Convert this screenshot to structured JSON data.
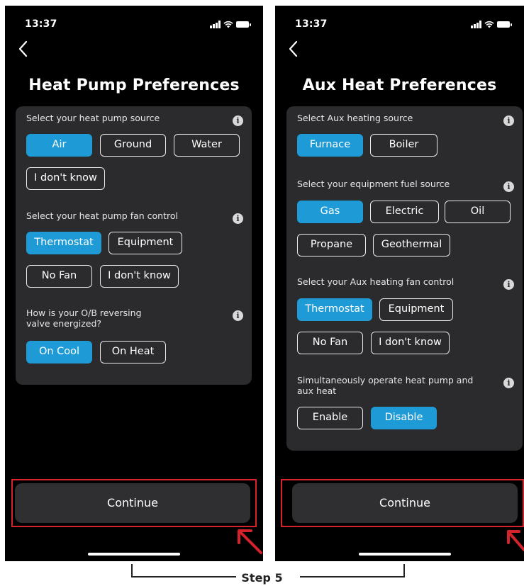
{
  "status": {
    "time": "13:37"
  },
  "left": {
    "title": "Heat Pump Preferences",
    "sections": [
      {
        "label": "Select your heat pump source",
        "options": [
          "Air",
          "Ground",
          "Water",
          "I don't know"
        ],
        "selected": "Air"
      },
      {
        "label": "Select your heat pump fan control",
        "options": [
          "Thermostat",
          "Equipment",
          "No Fan",
          "I don't know"
        ],
        "selected": "Thermostat"
      },
      {
        "label": "How is your O/B reversing valve energized?",
        "options": [
          "On Cool",
          "On Heat"
        ],
        "selected": "On Cool"
      }
    ],
    "continue_label": "Continue"
  },
  "right": {
    "title": "Aux Heat Preferences",
    "sections": [
      {
        "label": "Select Aux heating source",
        "options": [
          "Furnace",
          "Boiler"
        ],
        "selected": "Furnace"
      },
      {
        "label": "Select your equipment fuel source",
        "options": [
          "Gas",
          "Electric",
          "Oil",
          "Propane",
          "Geothermal"
        ],
        "selected": "Gas"
      },
      {
        "label": "Select your Aux heating fan control",
        "options": [
          "Thermostat",
          "Equipment",
          "No Fan",
          "I don't know"
        ],
        "selected": "Thermostat"
      },
      {
        "label": "Simultaneously operate heat pump and aux heat",
        "options": [
          "Enable",
          "Disable"
        ],
        "selected": "Disable"
      }
    ],
    "continue_label": "Continue"
  },
  "step_label": "Step 5",
  "colors": {
    "accent": "#1e9bd7",
    "highlight": "#d4232a",
    "card": "#2b2b2d"
  }
}
